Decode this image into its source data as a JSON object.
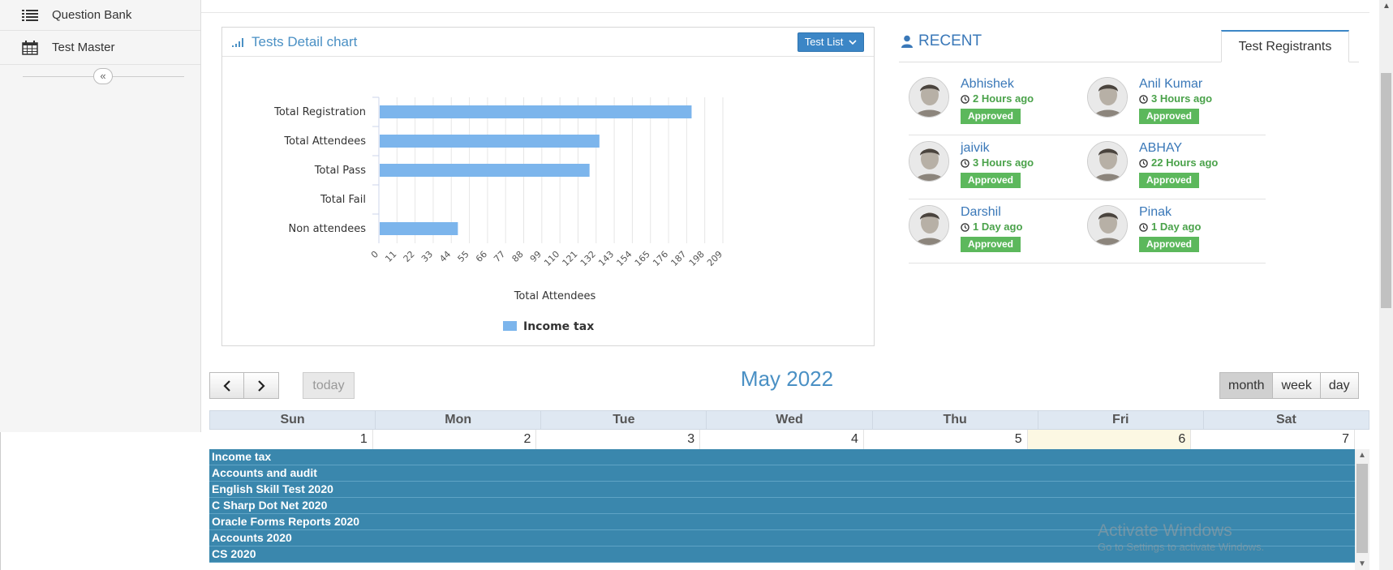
{
  "sidebar": {
    "items": [
      {
        "label": "Question Bank",
        "icon": "list-icon"
      },
      {
        "label": "Test Master",
        "icon": "calendar-icon"
      }
    ],
    "collapse_glyph": "«"
  },
  "chart_panel": {
    "title": "Tests Detail chart",
    "dropdown_label": "Test List",
    "dropdown_chevron": "⌄"
  },
  "chart_data": {
    "type": "bar",
    "orientation": "horizontal",
    "categories": [
      "Total Registration",
      "Total Attendees",
      "Total Pass",
      "Total Fail",
      "Non attendees"
    ],
    "series": [
      {
        "name": "Income tax",
        "values": [
          190,
          134,
          128,
          0,
          48
        ],
        "color": "#7cb5ec"
      }
    ],
    "xlabel": "Total Attendees",
    "ylabel": "",
    "xlim": [
      0,
      209
    ],
    "xticks": [
      0,
      11,
      22,
      33,
      44,
      55,
      66,
      77,
      88,
      99,
      110,
      121,
      132,
      143,
      154,
      165,
      176,
      187,
      198,
      209
    ],
    "grid": true,
    "legend": "bottom-center"
  },
  "recent": {
    "title": "RECENT",
    "tab": "Test Registrants",
    "registrants": [
      {
        "name": "Abhishek",
        "time": "2 Hours ago",
        "status": "Approved"
      },
      {
        "name": "Anil Kumar",
        "time": "3 Hours ago",
        "status": "Approved"
      },
      {
        "name": "jaivik",
        "time": "3 Hours ago",
        "status": "Approved"
      },
      {
        "name": "ABHAY",
        "time": "22 Hours ago",
        "status": "Approved"
      },
      {
        "name": "Darshil",
        "time": "1 Day ago",
        "status": "Approved"
      },
      {
        "name": "Pinak",
        "time": "1 Day ago",
        "status": "Approved"
      }
    ]
  },
  "calendar": {
    "prev_glyph": "<",
    "next_glyph": ">",
    "today_label": "today",
    "title": "May 2022",
    "views": [
      "month",
      "week",
      "day"
    ],
    "active_view": "month",
    "weekdays": [
      "Sun",
      "Mon",
      "Tue",
      "Wed",
      "Thu",
      "Fri",
      "Sat"
    ],
    "day_numbers": [
      "1",
      "2",
      "3",
      "4",
      "5",
      "6",
      "7"
    ],
    "today_index": 5,
    "events": [
      "Income tax",
      "Accounts and audit",
      "English Skill Test 2020",
      "C Sharp Dot Net 2020",
      "Oracle Forms Reports 2020",
      "Accounts 2020",
      "CS 2020"
    ],
    "event_color": "#3a87ad"
  },
  "watermark": {
    "line1": "Activate Windows",
    "line2": "Go to Settings to activate Windows."
  }
}
